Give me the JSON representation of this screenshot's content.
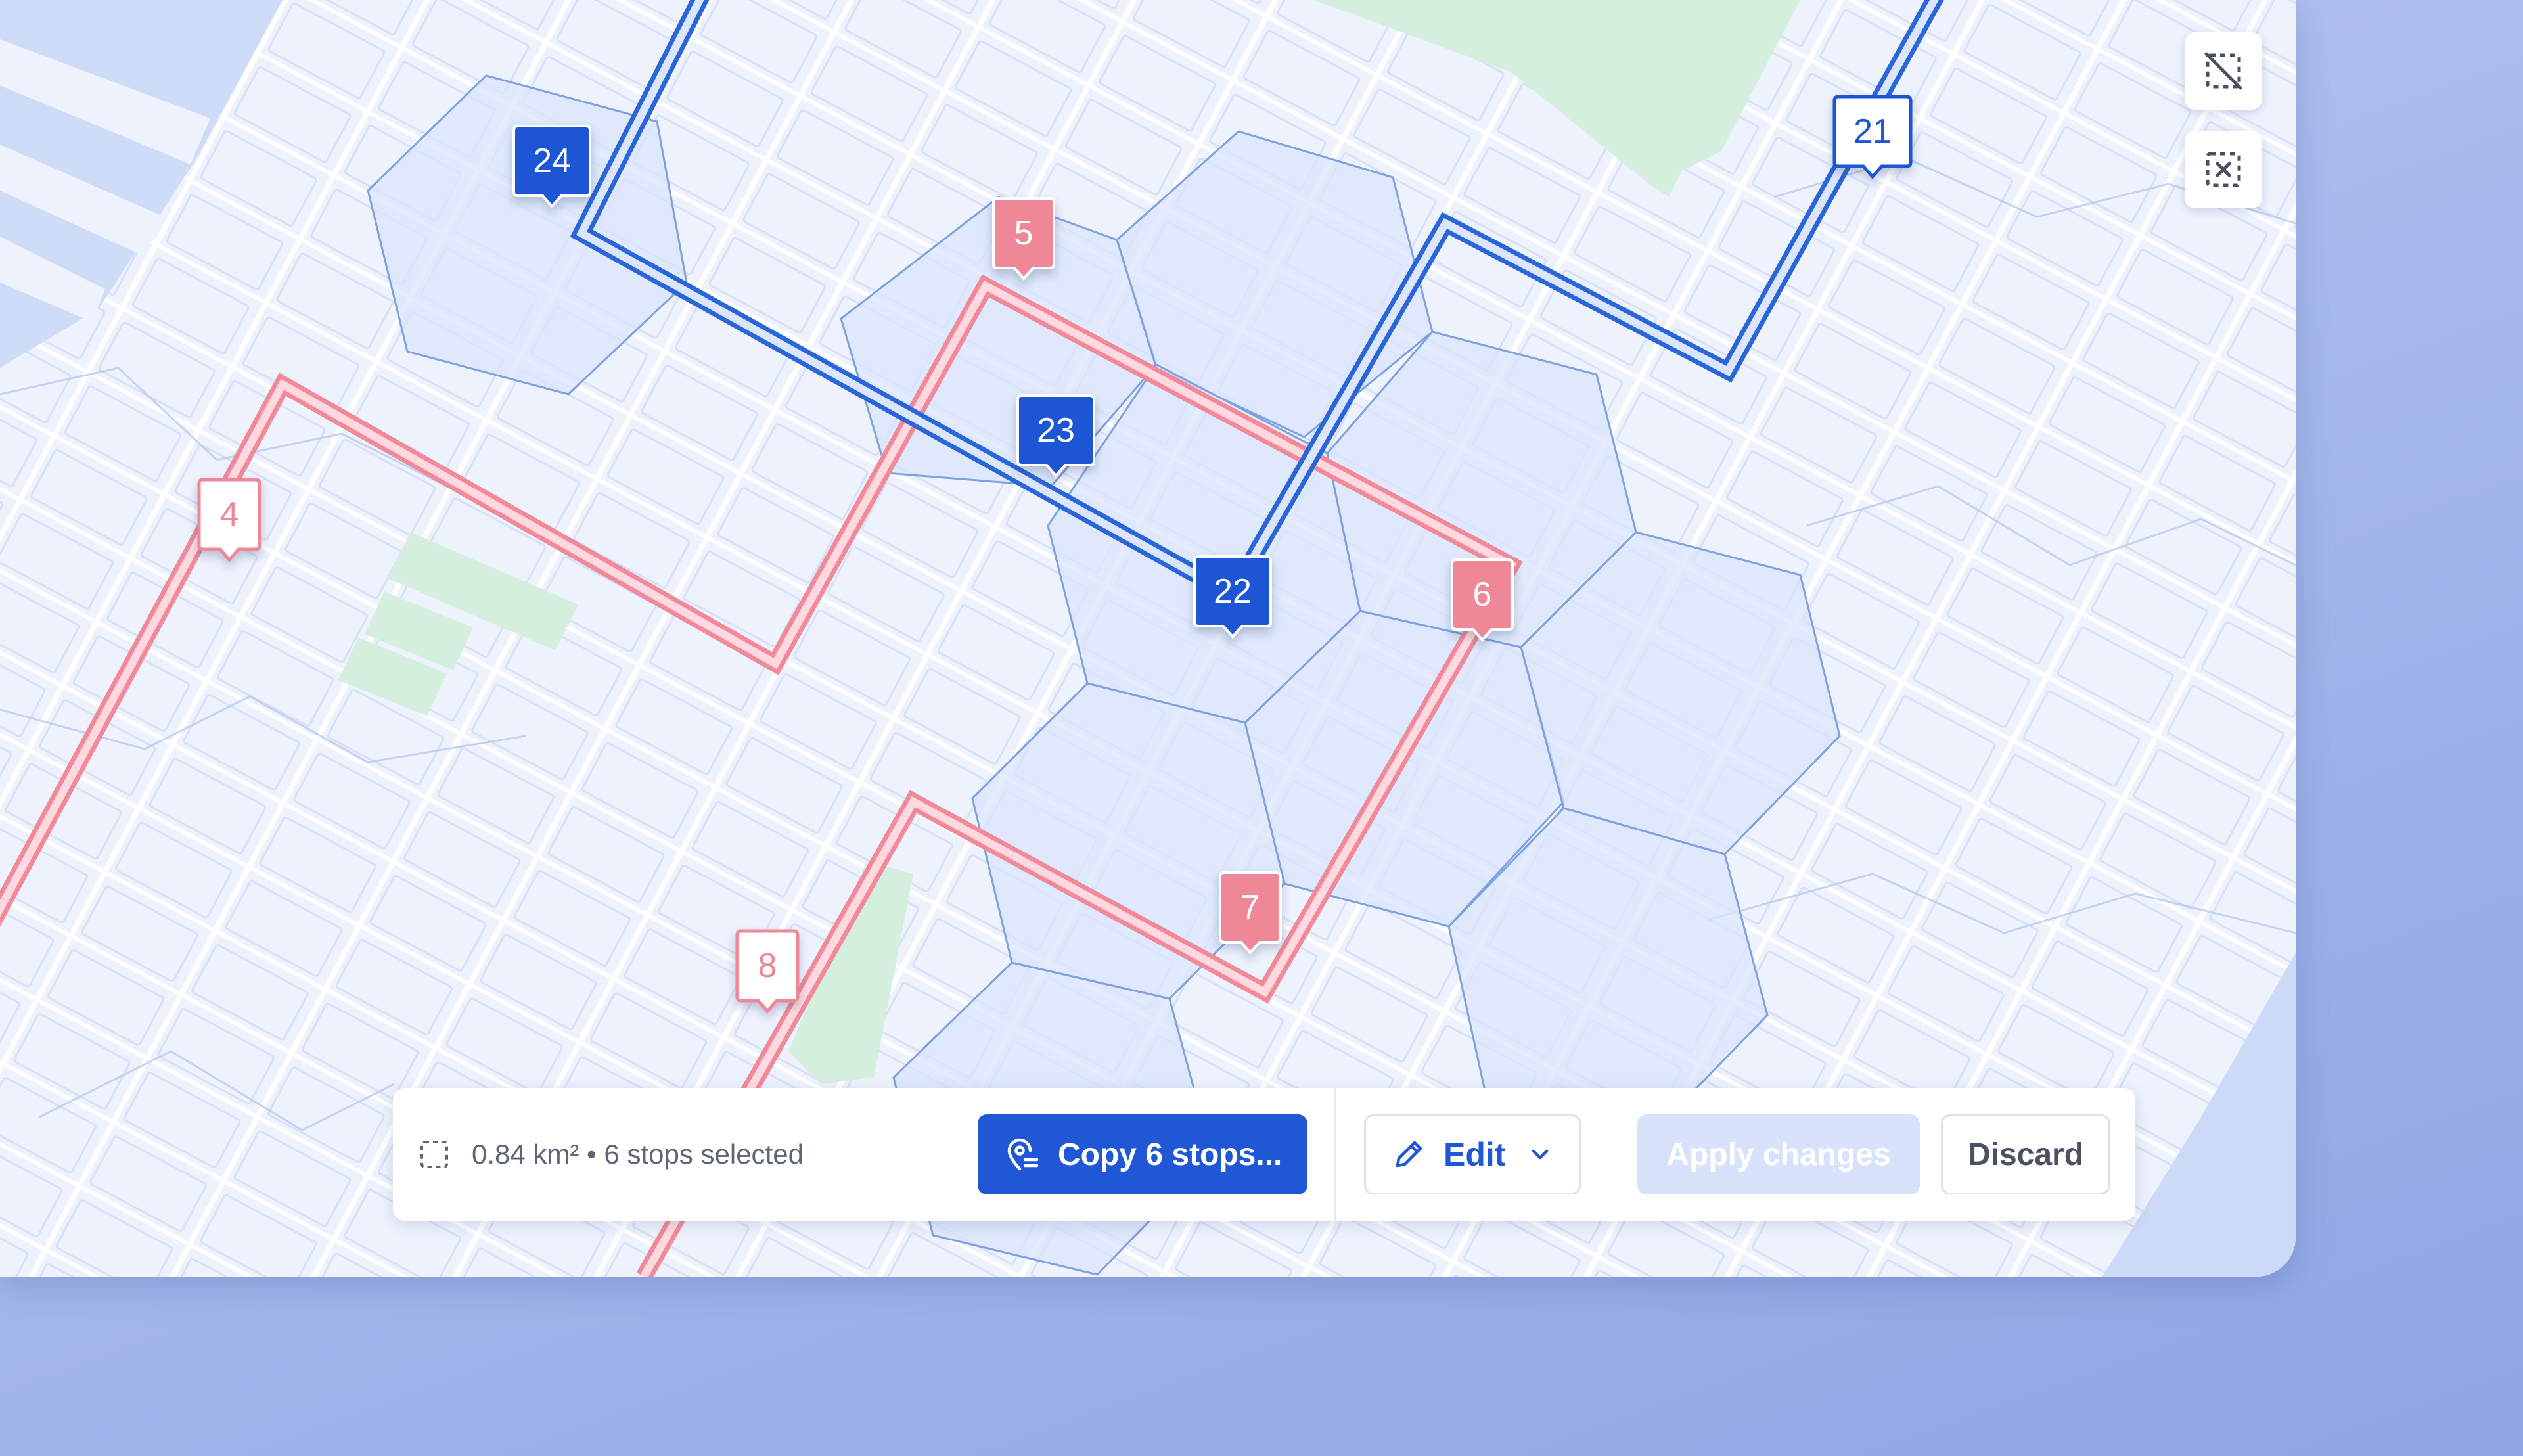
{
  "map": {
    "routes": [
      {
        "name": "",
        "color": "#2a66d8",
        "stops": [
          {
            "label": "21",
            "style": "outline"
          },
          {
            "label": "22",
            "style": "filled"
          },
          {
            "label": "23",
            "style": "filled"
          },
          {
            "label": "24",
            "style": "filled"
          }
        ]
      },
      {
        "name": "",
        "color": "#f08a9a",
        "stops": [
          {
            "label": "4",
            "style": "outline"
          },
          {
            "label": "5",
            "style": "filled"
          },
          {
            "label": "6",
            "style": "filled"
          },
          {
            "label": "7",
            "style": "filled"
          },
          {
            "label": "8",
            "style": "outline"
          }
        ]
      }
    ],
    "controls": [
      {
        "icon": "deselect-icon"
      },
      {
        "icon": "clear-selection-icon"
      }
    ]
  },
  "toolbar": {
    "summary": "0.84 km² • 6 stops selected",
    "selection_icon": "selection-area-icon",
    "copy_label": "Copy 6 stops...",
    "copy_icon": "location-copy-icon",
    "edit_label": "Edit",
    "edit_icon": "pencil-icon",
    "apply_label": "Apply changes",
    "apply_enabled": false,
    "discard_label": "Discard"
  },
  "colors": {
    "primary": "#1f57d4",
    "route_blue": "#2a66d8",
    "route_pink": "#f08a9a",
    "hex_fill": "#dbe5fb",
    "park": "#d4efdf",
    "water": "#ccdaf7"
  }
}
